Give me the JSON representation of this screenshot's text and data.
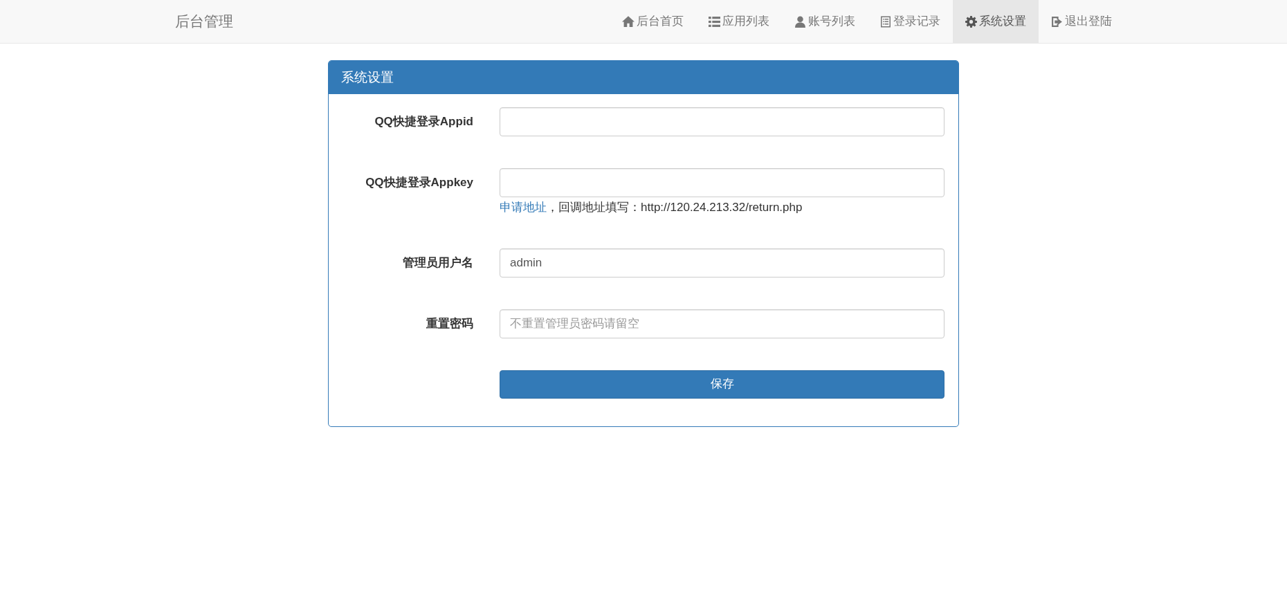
{
  "navbar": {
    "brand": "后台管理",
    "items": [
      {
        "label": "后台首页",
        "selected": false
      },
      {
        "label": "应用列表",
        "selected": false
      },
      {
        "label": "账号列表",
        "selected": false
      },
      {
        "label": "登录记录",
        "selected": false
      },
      {
        "label": "系统设置",
        "selected": true
      },
      {
        "label": "退出登陆",
        "selected": false
      }
    ]
  },
  "panel": {
    "title": "系统设置",
    "fields": [
      {
        "label": "QQ快捷登录Appid"
      },
      {
        "label": "QQ快捷登录Appkey",
        "help": {
          "link": "申请地址",
          "text": "，回调地址填写：http://120.24.213.32/return.php"
        }
      },
      {
        "label": "管理员用户名",
        "value": "admin"
      },
      {
        "label": "重置密码",
        "placeholder": "不重置管理员密码请留空"
      }
    ],
    "submit": "保存"
  }
}
